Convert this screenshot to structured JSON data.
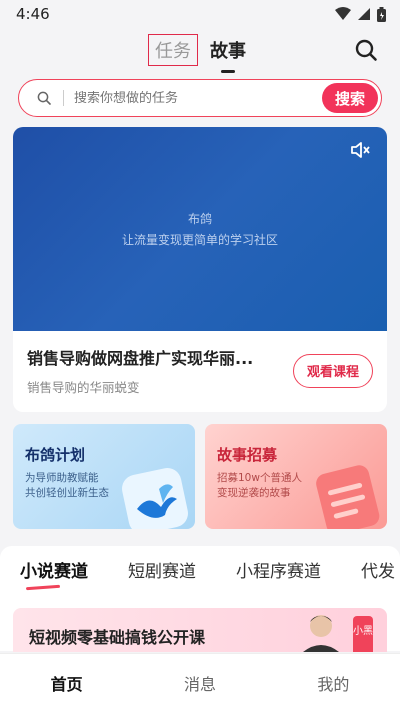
{
  "status": {
    "time": "4:46"
  },
  "header": {
    "tabs": [
      {
        "label": "任务"
      },
      {
        "label": "故事"
      }
    ]
  },
  "search": {
    "placeholder": "搜索你想做的任务",
    "button": "搜索"
  },
  "banner": {
    "video_title": "布鸽",
    "video_subtitle": "让流量变现更简单的学习社区",
    "course_title": "销售导购做网盘推广实现华丽...",
    "course_subtitle": "销售导购的华丽蜕变",
    "watch_button": "观看课程"
  },
  "promos": [
    {
      "title": "布鸽计划",
      "line1": "为导师助教赋能",
      "line2": "共创轻创业新生态"
    },
    {
      "title": "故事招募",
      "line1": "招募10w个普通人",
      "line2": "变现逆袭的故事"
    }
  ],
  "tracks": [
    "小说赛道",
    "短剧赛道",
    "小程序赛道",
    "代发"
  ],
  "feed": {
    "title": "短视频零基础搞钱公开课",
    "tag": "小黑"
  },
  "nav": [
    {
      "label": "首页"
    },
    {
      "label": "消息"
    },
    {
      "label": "我的"
    }
  ],
  "colors": {
    "accent": "#f2335a",
    "banner_blue": "#1f4fa7"
  },
  "icons": {
    "search": "search-icon",
    "mute": "volume-mute-icon",
    "wifi": "wifi-icon",
    "signal": "signal-icon",
    "battery": "battery-icon"
  }
}
